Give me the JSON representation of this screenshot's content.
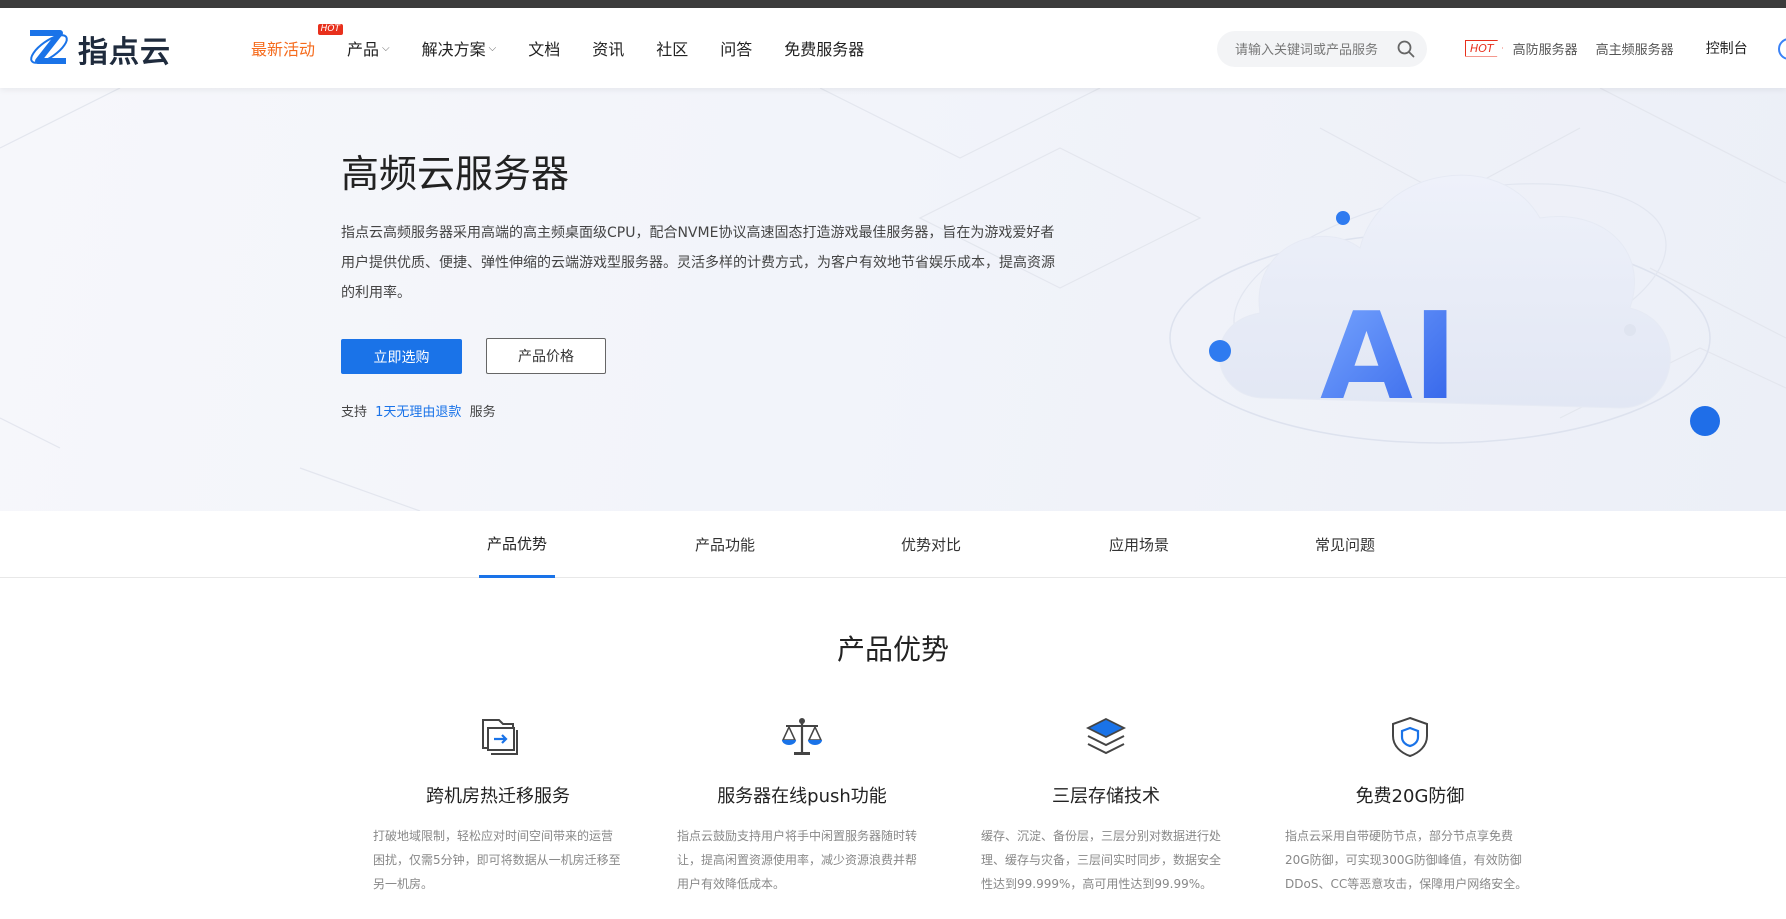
{
  "brand": {
    "name": "指点云",
    "primary_color": "#1a73e8",
    "accent_color": "#f56b1d",
    "hot_color": "#e8301c"
  },
  "nav": {
    "items": [
      {
        "label": "最新活动",
        "active": true,
        "hot": true,
        "hot_label": "HOT"
      },
      {
        "label": "产品",
        "dropdown": true
      },
      {
        "label": "解决方案",
        "dropdown": true
      },
      {
        "label": "文档"
      },
      {
        "label": "资讯"
      },
      {
        "label": "社区"
      },
      {
        "label": "问答"
      },
      {
        "label": "免费服务器"
      }
    ],
    "search_placeholder": "请输入关键词或产品服务",
    "hot_badge": "HOT",
    "right_links": [
      "高防服务器",
      "高主频服务器"
    ],
    "console": "控制台"
  },
  "hero": {
    "title": "高频云服务器",
    "description": "指点云高频服务器采用高端的高主频桌面级CPU，配合NVME协议高速固态打造游戏最佳服务器，旨在为游戏爱好者用户提供优质、便捷、弹性伸缩的云端游戏型服务器。灵活多样的计费方式，为客户有效地节省娱乐成本，提高资源的利用率。",
    "buy_button": "立即选购",
    "price_button": "产品价格",
    "support_prefix": "支持",
    "support_link": "1天无理由退款",
    "support_suffix": "服务",
    "art_text": "AI"
  },
  "tabs": [
    {
      "label": "产品优势",
      "active": true
    },
    {
      "label": "产品功能"
    },
    {
      "label": "优势对比"
    },
    {
      "label": "应用场景"
    },
    {
      "label": "常见问题"
    }
  ],
  "advantages": {
    "title": "产品优势",
    "items": [
      {
        "icon": "migrate-icon",
        "title": "跨机房热迁移服务",
        "desc": "打破地域限制，轻松应对时间空间带来的运营困扰，仅需5分钟，即可将数据从一机房迁移至另一机房。"
      },
      {
        "icon": "scale-icon",
        "title": "服务器在线push功能",
        "desc": "指点云鼓励支持用户将手中闲置服务器随时转让，提高闲置资源使用率，减少资源浪费并帮用户有效降低成本。"
      },
      {
        "icon": "layers-icon",
        "title": "三层存储技术",
        "desc": "缓存、沉淀、备份层，三层分别对数据进行处理、缓存与灾备，三层间实时同步，数据安全性达到99.999%，高可用性达到99.99%。"
      },
      {
        "icon": "shield-icon",
        "title": "免费20G防御",
        "desc": "指点云采用自带硬防节点，部分节点享免费20G防御，可实现300G防御峰值，有效防御DDoS、CC等恶意攻击，保障用户网络安全。"
      }
    ]
  }
}
